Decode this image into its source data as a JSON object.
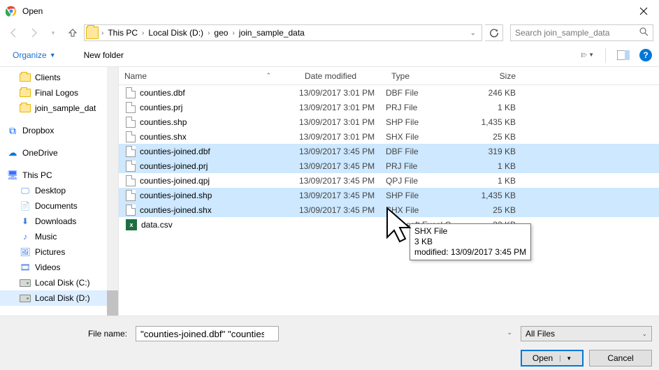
{
  "window": {
    "title": "Open"
  },
  "breadcrumbs": [
    "This PC",
    "Local Disk (D:)",
    "geo",
    "join_sample_data"
  ],
  "search": {
    "placeholder": "Search join_sample_data"
  },
  "toolbar": {
    "organize": "Organize",
    "newfolder": "New folder"
  },
  "sidebar": {
    "favorites": [
      "Clients",
      "Final Logos",
      "join_sample_dat"
    ],
    "dropbox": "Dropbox",
    "onedrive": "OneDrive",
    "thispc": "This PC",
    "pcitems": [
      "Desktop",
      "Documents",
      "Downloads",
      "Music",
      "Pictures",
      "Videos",
      "Local Disk (C:)",
      "Local Disk (D:)"
    ]
  },
  "columns": {
    "name": "Name",
    "date": "Date modified",
    "type": "Type",
    "size": "Size"
  },
  "files": [
    {
      "name": "counties.dbf",
      "date": "13/09/2017 3:01 PM",
      "type": "DBF File",
      "size": "246 KB",
      "sel": false,
      "icon": "file"
    },
    {
      "name": "counties.prj",
      "date": "13/09/2017 3:01 PM",
      "type": "PRJ File",
      "size": "1 KB",
      "sel": false,
      "icon": "file"
    },
    {
      "name": "counties.shp",
      "date": "13/09/2017 3:01 PM",
      "type": "SHP File",
      "size": "1,435 KB",
      "sel": false,
      "icon": "file"
    },
    {
      "name": "counties.shx",
      "date": "13/09/2017 3:01 PM",
      "type": "SHX File",
      "size": "25 KB",
      "sel": false,
      "icon": "file"
    },
    {
      "name": "counties-joined.dbf",
      "date": "13/09/2017 3:45 PM",
      "type": "DBF File",
      "size": "319 KB",
      "sel": true,
      "icon": "file"
    },
    {
      "name": "counties-joined.prj",
      "date": "13/09/2017 3:45 PM",
      "type": "PRJ File",
      "size": "1 KB",
      "sel": true,
      "icon": "file"
    },
    {
      "name": "counties-joined.qpj",
      "date": "13/09/2017 3:45 PM",
      "type": "QPJ File",
      "size": "1 KB",
      "sel": false,
      "icon": "file"
    },
    {
      "name": "counties-joined.shp",
      "date": "13/09/2017 3:45 PM",
      "type": "SHP File",
      "size": "1,435 KB",
      "sel": true,
      "icon": "file"
    },
    {
      "name": "counties-joined.shx",
      "date": "13/09/2017 3:45 PM",
      "type": "SHX File",
      "size": "25 KB",
      "sel": true,
      "icon": "file"
    },
    {
      "name": "data.csv",
      "date": "",
      "type": "Microsoft Excel C...",
      "size": "33 KB",
      "sel": false,
      "icon": "excel"
    }
  ],
  "tooltip": {
    "line1": "SHX File",
    "line2": "3 KB",
    "line3": "modified: 13/09/2017 3:45 PM"
  },
  "filename": {
    "label": "File name:",
    "value": "\"counties-joined.dbf\" \"counties-joined.prj\" \"counties-joined.shp\" \"counties-joined.shx\""
  },
  "filter": {
    "value": "All Files"
  },
  "buttons": {
    "open": "Open",
    "cancel": "Cancel"
  }
}
